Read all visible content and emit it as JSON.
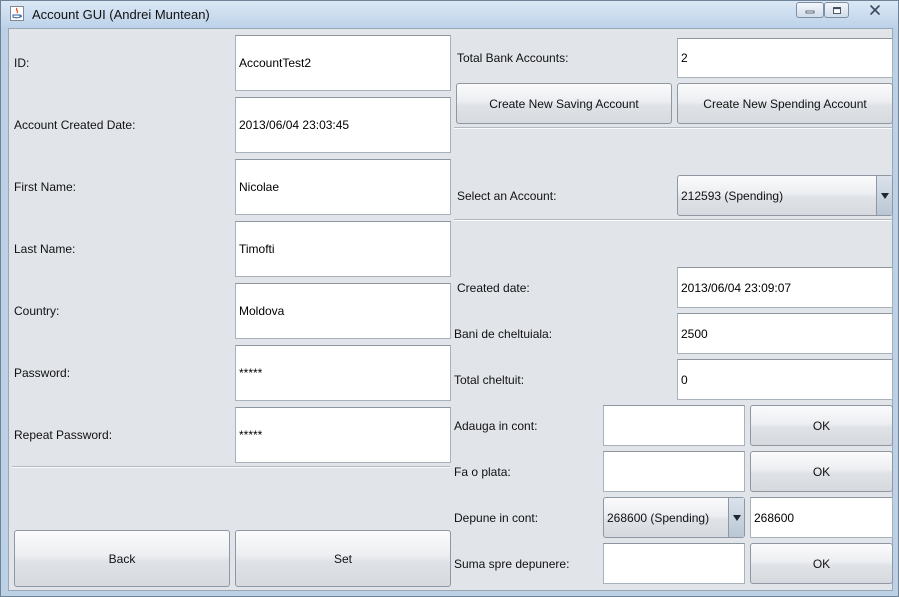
{
  "window": {
    "title": "Account GUI (Andrei Muntean)"
  },
  "left": {
    "id_label": "ID:",
    "id_value": "AccountTest2",
    "created_label": "Account Created Date:",
    "created_value": "2013/06/04 23:03:45",
    "first_label": "First Name:",
    "first_value": "Nicolae",
    "last_label": "Last Name:",
    "last_value": "Timofti",
    "country_label": "Country:",
    "country_value": "Moldova",
    "password_label": "Password:",
    "password_value": "*****",
    "repeat_label": "Repeat Password:",
    "repeat_value": "*****",
    "back_label": "Back",
    "set_label": "Set"
  },
  "right": {
    "total_label": "Total Bank Accounts:",
    "total_value": "2",
    "new_saving_label": "Create New Saving Account",
    "new_spending_label": "Create New Spending Account",
    "select_label": "Select an Account:",
    "select_value": "212593 (Spending)",
    "created_label": "Created date:",
    "created_value": "2013/06/04 23:09:07",
    "bani_label": "Bani de cheltuiala:",
    "bani_value": "2500",
    "total_cheltuit_label": "Total cheltuit:",
    "total_cheltuit_value": "0",
    "adauga_label": "Adauga in cont:",
    "adauga_value": "",
    "adauga_ok": "OK",
    "plata_label": "Fa o plata:",
    "plata_value": "",
    "plata_ok": "OK",
    "depune_label": "Depune in cont:",
    "depune_select": "268600 (Spending)",
    "depune_value": "268600",
    "suma_label": "Suma spre depunere:",
    "suma_value": "",
    "suma_ok": "OK"
  },
  "colors": {
    "window_frame": "#bcd0e6",
    "panel_bg": "#e1e4e9",
    "field_bg": "#ffffff"
  }
}
